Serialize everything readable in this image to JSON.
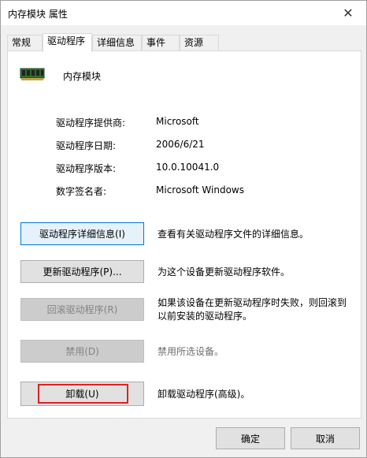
{
  "window": {
    "title": "内存模块 属性",
    "close_glyph": "✕"
  },
  "tabs": [
    {
      "label": "常规",
      "active": false
    },
    {
      "label": "驱动程序",
      "active": true
    },
    {
      "label": "详细信息",
      "active": false
    },
    {
      "label": "事件",
      "active": false
    },
    {
      "label": "资源",
      "active": false
    }
  ],
  "device": {
    "name": "内存模块",
    "icon": "memory-module-icon"
  },
  "driver_info": [
    {
      "label": "驱动程序提供商:",
      "value": "Microsoft"
    },
    {
      "label": "驱动程序日期:",
      "value": "2006/6/21"
    },
    {
      "label": "驱动程序版本:",
      "value": "10.0.10041.0"
    },
    {
      "label": "数字签名者:",
      "value": "Microsoft Windows"
    }
  ],
  "actions": [
    {
      "button": "驱动程序详细信息(I)",
      "description": "查看有关驱动程序文件的详细信息。",
      "enabled": true
    },
    {
      "button": "更新驱动程序(P)...",
      "description": "为这个设备更新驱动程序软件。",
      "enabled": true
    },
    {
      "button": "回滚驱动程序(R)",
      "description": "如果该设备在更新驱动程序时失败，则回滚到以前安装的驱动程序。",
      "enabled": false
    },
    {
      "button": "禁用(D)",
      "description": "禁用所选设备。",
      "enabled": false
    },
    {
      "button": "卸载(U)",
      "description": "卸载驱动程序(高级)。",
      "enabled": true
    }
  ],
  "footer": {
    "ok_label": "确定",
    "cancel_label": "取消"
  },
  "colors": {
    "highlight_box": "#e02020",
    "focus_border": "#0078d7"
  }
}
